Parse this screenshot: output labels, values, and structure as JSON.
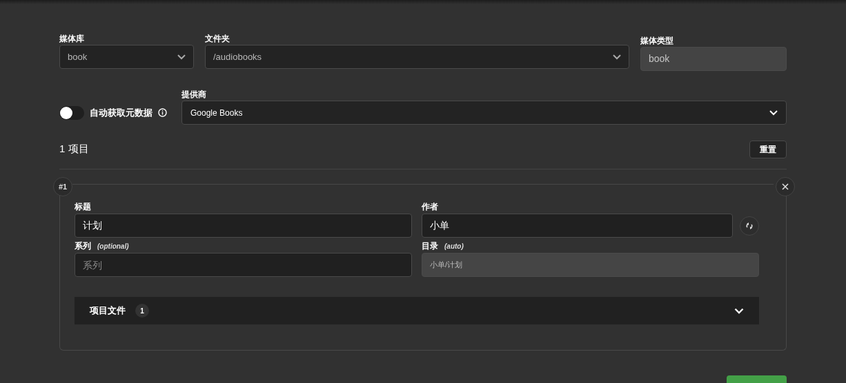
{
  "library": {
    "label": "媒体库",
    "value": "book"
  },
  "folder": {
    "label": "文件夹",
    "value": "/audiobooks"
  },
  "media_type": {
    "label": "媒体类型",
    "value": "book",
    "disabled": true
  },
  "auto_fetch": {
    "label": "自动获取元数据",
    "on": false
  },
  "provider": {
    "label": "提供商",
    "value": "Google Books"
  },
  "items_count": "1 项目",
  "reset_button": "重置",
  "items": [
    {
      "number": "#1",
      "fields": [
        {
          "label": "标题",
          "value": "计划",
          "disabled": false
        },
        {
          "label": "作者",
          "value": "小单",
          "disabled": false
        },
        {
          "label": "系列",
          "note": "(optional)",
          "placeholder": "系列",
          "disabled": false
        },
        {
          "label": "目录",
          "note": "(auto)",
          "value": "小单/计划",
          "disabled": true
        }
      ],
      "files": {
        "label": "项目文件",
        "count": "1",
        "expanded": false
      }
    }
  ]
}
